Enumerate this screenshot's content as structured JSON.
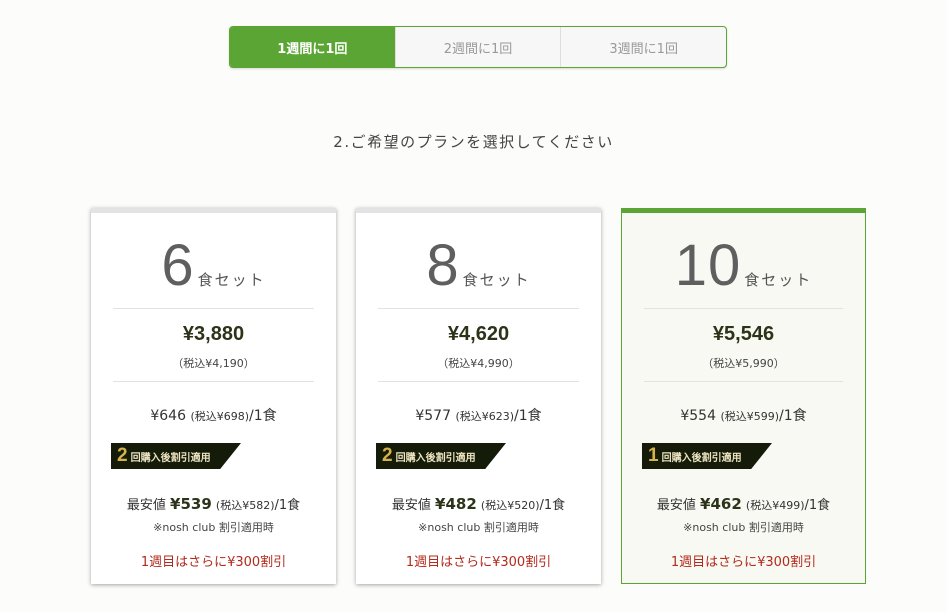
{
  "tabs": [
    {
      "label": "1週間に1回",
      "active": true
    },
    {
      "label": "2週間に1回",
      "active": false
    },
    {
      "label": "3週間に1回",
      "active": false
    }
  ],
  "prompt": "2.ご希望のプランを選択してください",
  "plans": [
    {
      "count": "6",
      "unit": "食セット",
      "price": "¥3,880",
      "price_tax": "（税込¥4,190）",
      "per_meal_price": "¥646",
      "per_meal_tax": "(税込¥698)",
      "per_meal_suffix": "/1食",
      "badge_num": "2",
      "badge_text": "回購入後割引適用",
      "lowest_label": "最安値",
      "lowest_price": "¥539",
      "lowest_tax": "(税込¥582)",
      "lowest_suffix": "/1食",
      "note": "※nosh club 割引適用時",
      "discount": "1週目はさらに¥300割引",
      "selected": false
    },
    {
      "count": "8",
      "unit": "食セット",
      "price": "¥4,620",
      "price_tax": "（税込¥4,990）",
      "per_meal_price": "¥577",
      "per_meal_tax": "(税込¥623)",
      "per_meal_suffix": "/1食",
      "badge_num": "2",
      "badge_text": "回購入後割引適用",
      "lowest_label": "最安値",
      "lowest_price": "¥482",
      "lowest_tax": "(税込¥520)",
      "lowest_suffix": "/1食",
      "note": "※nosh club 割引適用時",
      "discount": "1週目はさらに¥300割引",
      "selected": false
    },
    {
      "count": "10",
      "unit": "食セット",
      "price": "¥5,546",
      "price_tax": "（税込¥5,990）",
      "per_meal_price": "¥554",
      "per_meal_tax": "(税込¥599)",
      "per_meal_suffix": "/1食",
      "badge_num": "1",
      "badge_text": "回購入後割引適用",
      "lowest_label": "最安値",
      "lowest_price": "¥462",
      "lowest_tax": "(税込¥499)",
      "lowest_suffix": "/1食",
      "note": "※nosh club 割引適用時",
      "discount": "1週目はさらに¥300割引",
      "selected": true
    }
  ],
  "colors": {
    "accent": "#5aa533",
    "badge_bg": "#141b08",
    "badge_number": "#d6b24b",
    "discount_text": "#b32a1e",
    "selected_card_bg": "#f8f9f2"
  }
}
